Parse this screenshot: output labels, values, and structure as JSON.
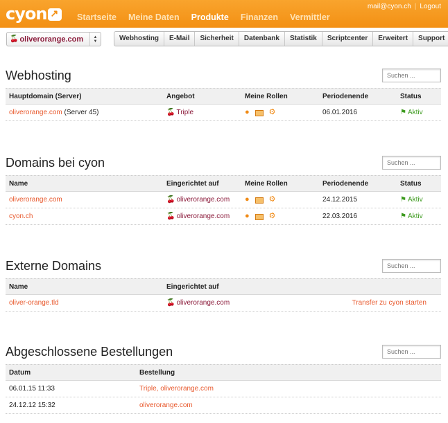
{
  "header": {
    "logo_text": "cyon",
    "nav": [
      "Startseite",
      "Meine Daten",
      "Produkte",
      "Finanzen",
      "Vermittler"
    ],
    "active_nav": "Produkte",
    "user_email": "mail@cyon.ch",
    "logout": "Logout"
  },
  "toolbar": {
    "selected_domain": "oliverorange.com",
    "tabs": [
      "Webhosting",
      "E-Mail",
      "Sicherheit",
      "Datenbank",
      "Statistik",
      "Scriptcenter",
      "Erweitert",
      "Support"
    ]
  },
  "search_placeholder": "Suchen ...",
  "webhosting": {
    "title": "Webhosting",
    "columns": [
      "Hauptdomain (Server)",
      "Angebot",
      "Meine Rollen",
      "Periodenende",
      "Status"
    ],
    "rows": [
      {
        "domain": "oliverorange.com",
        "server": "(Server 45)",
        "offer": "Triple",
        "period_end": "06.01.2016",
        "status": "Aktiv"
      }
    ]
  },
  "domains": {
    "title": "Domains bei cyon",
    "columns": [
      "Name",
      "Eingerichtet auf",
      "Meine Rollen",
      "Periodenende",
      "Status"
    ],
    "rows": [
      {
        "name": "oliverorange.com",
        "setup": "oliverorange.com",
        "period_end": "24.12.2015",
        "status": "Aktiv"
      },
      {
        "name": "cyon.ch",
        "setup": "oliverorange.com",
        "period_end": "22.03.2016",
        "status": "Aktiv"
      }
    ]
  },
  "external": {
    "title": "Externe Domains",
    "columns": [
      "Name",
      "Eingerichtet auf"
    ],
    "rows": [
      {
        "name": "oliver-orange.tld",
        "setup": "oliverorange.com",
        "action": "Transfer zu cyon starten"
      }
    ]
  },
  "orders": {
    "title": "Abgeschlossene Bestellungen",
    "columns": [
      "Datum",
      "Bestellung"
    ],
    "rows": [
      {
        "date": "06.01.15 11:33",
        "order": "Triple, oliverorange.com"
      },
      {
        "date": "24.12.12 15:32",
        "order": "oliverorange.com"
      }
    ]
  }
}
